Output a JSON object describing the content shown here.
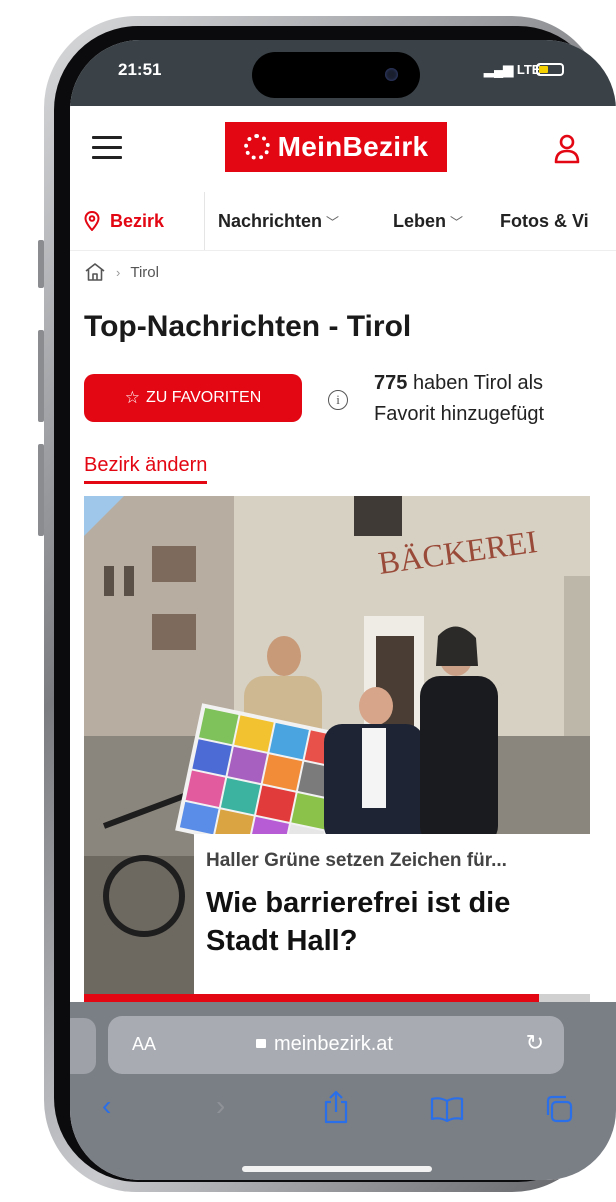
{
  "status": {
    "time": "21:51",
    "network": "LTE",
    "battery_fraction": 0.4
  },
  "header": {
    "logo_text": "MeinBezirk",
    "brand_color": "#e30613",
    "menu_icon": "hamburger-icon",
    "account_icon": "user-icon"
  },
  "nav": {
    "bezirk_label": "Bezirk",
    "items": [
      {
        "label": "Nachrichten",
        "has_dropdown": true
      },
      {
        "label": "Leben",
        "has_dropdown": true
      },
      {
        "label": "Fotos & Vi",
        "has_dropdown": false
      }
    ]
  },
  "breadcrumb": {
    "home_icon": "home-icon",
    "current": "Tirol"
  },
  "page": {
    "title": "Top-Nachrichten - Tirol",
    "favorite_button": "ZU FAVORITEN",
    "favorite_count": "775",
    "favorite_text_line1": "haben Tirol als",
    "favorite_text_line2": "Favorit hinzugefügt",
    "change_district": "Bezirk ändern"
  },
  "article": {
    "kicker": "Haller Grüne setzen Zeichen für...",
    "headline": "Wie barrierefrei ist die Stadt Hall?",
    "photo_sign": "BÄCKEREI",
    "slide_progress": 0.9
  },
  "browser": {
    "text_size_label": "AA",
    "url": "meinbezirk.at",
    "toolbar_icons": [
      "back-icon",
      "forward-icon",
      "share-icon",
      "bookmarks-icon",
      "tabs-icon"
    ]
  }
}
